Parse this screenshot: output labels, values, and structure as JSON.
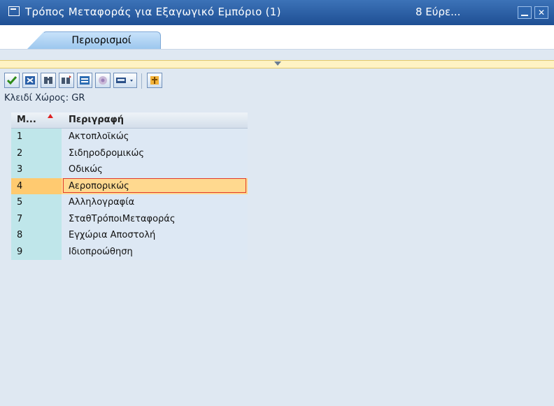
{
  "window": {
    "title": "Τρόπος Μεταφοράς για Εξαγωγικό Εμπόριο (1)",
    "count": "8 Εύρε..."
  },
  "tabs": [
    {
      "label": "Περιορισμοί"
    }
  ],
  "toolbar": {
    "buttons": [
      "check-icon",
      "cancel-icon",
      "find-icon",
      "find-next-icon",
      "layout-icon",
      "help-icon",
      "print-icon",
      "filter-icon"
    ]
  },
  "key_field": {
    "label": "Κλειδί Χώρος: GR"
  },
  "table": {
    "columns": [
      "M...",
      "Περιγραφή"
    ],
    "selected_index": 3,
    "rows": [
      {
        "key": "1",
        "desc": "Ακτοπλοϊκώς"
      },
      {
        "key": "2",
        "desc": "Σιδηροδρομικώς"
      },
      {
        "key": "3",
        "desc": "Οδικώς"
      },
      {
        "key": "4",
        "desc": "Αεροπορικώς"
      },
      {
        "key": "5",
        "desc": "Αλληλογραφία"
      },
      {
        "key": "7",
        "desc": "ΣταθΤρόποιΜεταφοράς"
      },
      {
        "key": "8",
        "desc": "Εγχώρια Αποστολή"
      },
      {
        "key": "9",
        "desc": "Ιδιοπροώθηση"
      }
    ]
  },
  "colors": {
    "title_bar": "#1e4f93",
    "key_column": "#bfe6ea",
    "selection": "#ffd98f",
    "focus_border": "#e23b2b"
  }
}
